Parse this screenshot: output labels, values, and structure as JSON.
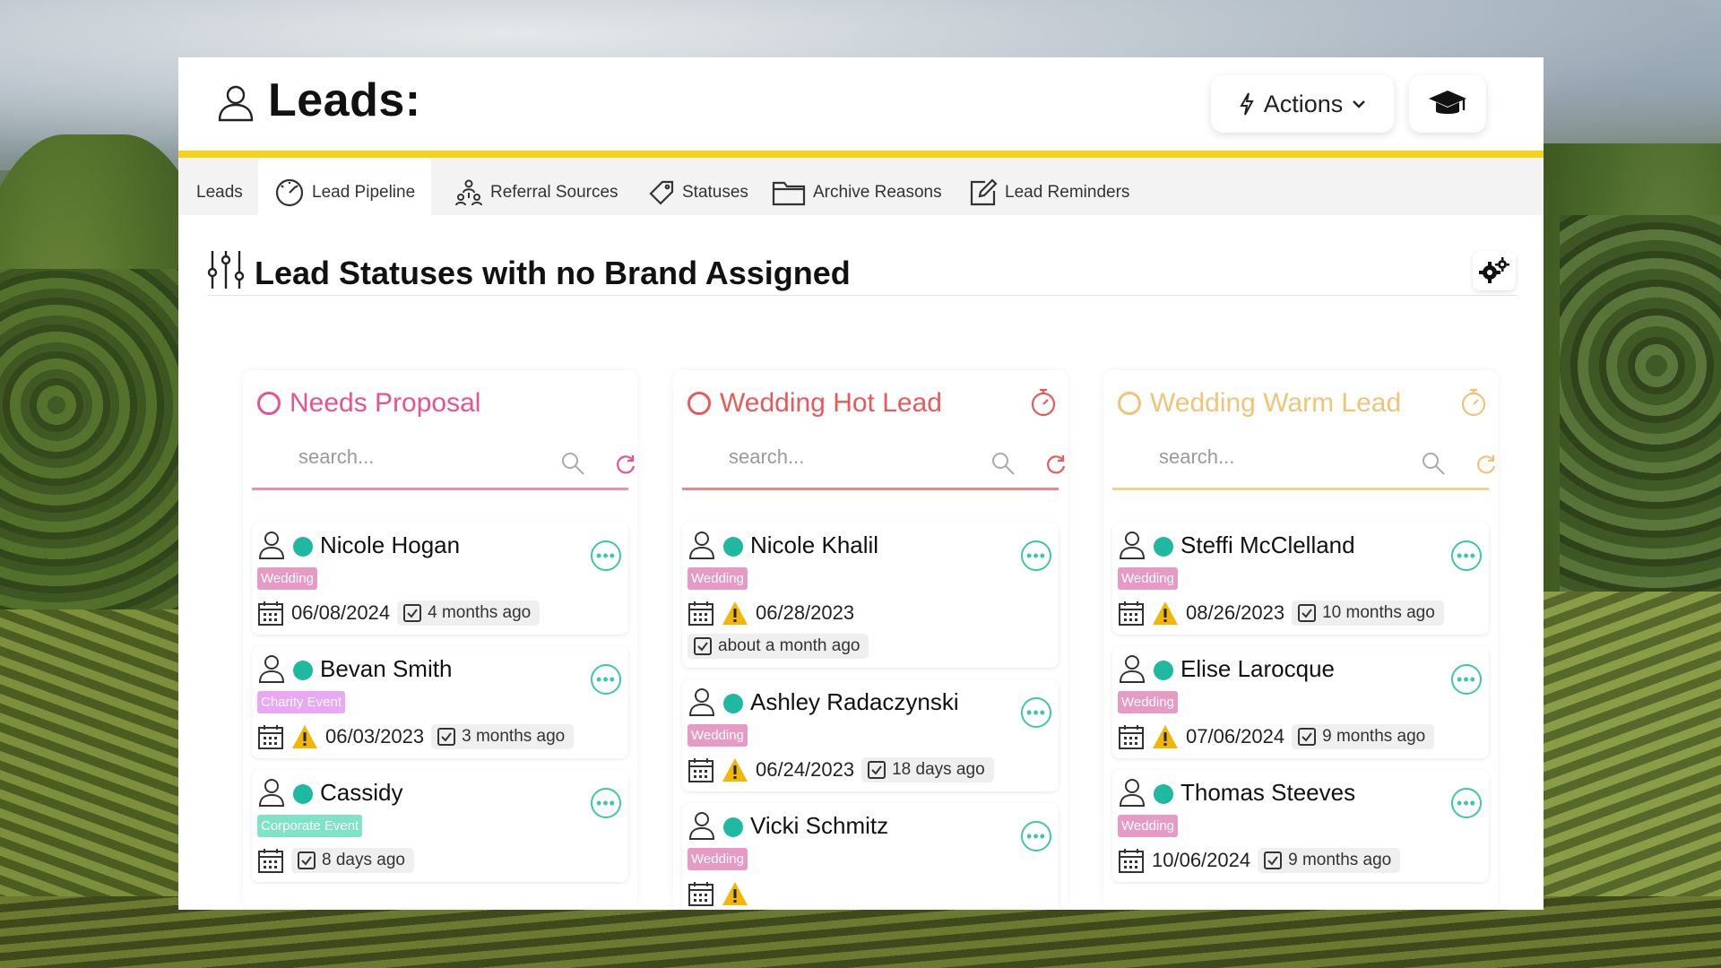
{
  "header": {
    "title": "Leads:",
    "actions_label": "Actions"
  },
  "tabs": [
    {
      "label": "Leads",
      "icon": "none"
    },
    {
      "label": "Lead Pipeline",
      "icon": "gauge-icon"
    },
    {
      "label": "Referral Sources",
      "icon": "people-network-icon"
    },
    {
      "label": "Statuses",
      "icon": "tag-icon"
    },
    {
      "label": "Archive Reasons",
      "icon": "folder-icon"
    },
    {
      "label": "Lead Reminders",
      "icon": "edit-icon"
    }
  ],
  "panel": {
    "title": "Lead Statuses with no Brand Assigned"
  },
  "colors": {
    "accent_yellow": "#f5d21b",
    "needs_proposal": "#e8528f",
    "hot_lead": "#e85a5a",
    "warm_lead": "#f0c478",
    "status_dot": "#1fb8a0"
  },
  "columns": [
    {
      "title": "Needs Proposal",
      "search_placeholder": "search...",
      "cards": [
        {
          "name": "Nicole Hogan",
          "tag": "Wedding",
          "date": "06/08/2024",
          "ago": "4 months ago",
          "warning": false
        },
        {
          "name": "Bevan Smith",
          "tag": "Charity Event",
          "date": "06/03/2023",
          "ago": "3 months ago",
          "warning": true
        },
        {
          "name": "Cassidy",
          "tag": "Corporate Event",
          "date": "",
          "ago": "8 days ago",
          "warning": false
        }
      ]
    },
    {
      "title": "Wedding Hot Lead",
      "search_placeholder": "search...",
      "cards": [
        {
          "name": "Nicole Khalil",
          "tag": "Wedding",
          "date": "06/28/2023",
          "ago": "about a month ago",
          "warning": true
        },
        {
          "name": "Ashley Radaczynski",
          "tag": "Wedding",
          "date": "06/24/2023",
          "ago": "18 days ago",
          "warning": true
        },
        {
          "name": "Vicki Schmitz",
          "tag": "Wedding",
          "date": "",
          "ago": "",
          "warning": true
        }
      ]
    },
    {
      "title": "Wedding Warm Lead",
      "search_placeholder": "search...",
      "cards": [
        {
          "name": "Steffi McClelland",
          "tag": "Wedding",
          "date": "08/26/2023",
          "ago": "10 months ago",
          "warning": true
        },
        {
          "name": "Elise Larocque",
          "tag": "Wedding",
          "date": "07/06/2024",
          "ago": "9 months ago",
          "warning": true
        },
        {
          "name": "Thomas Steeves",
          "tag": "Wedding",
          "date": "10/06/2024",
          "ago": "9 months ago",
          "warning": false
        }
      ]
    }
  ]
}
